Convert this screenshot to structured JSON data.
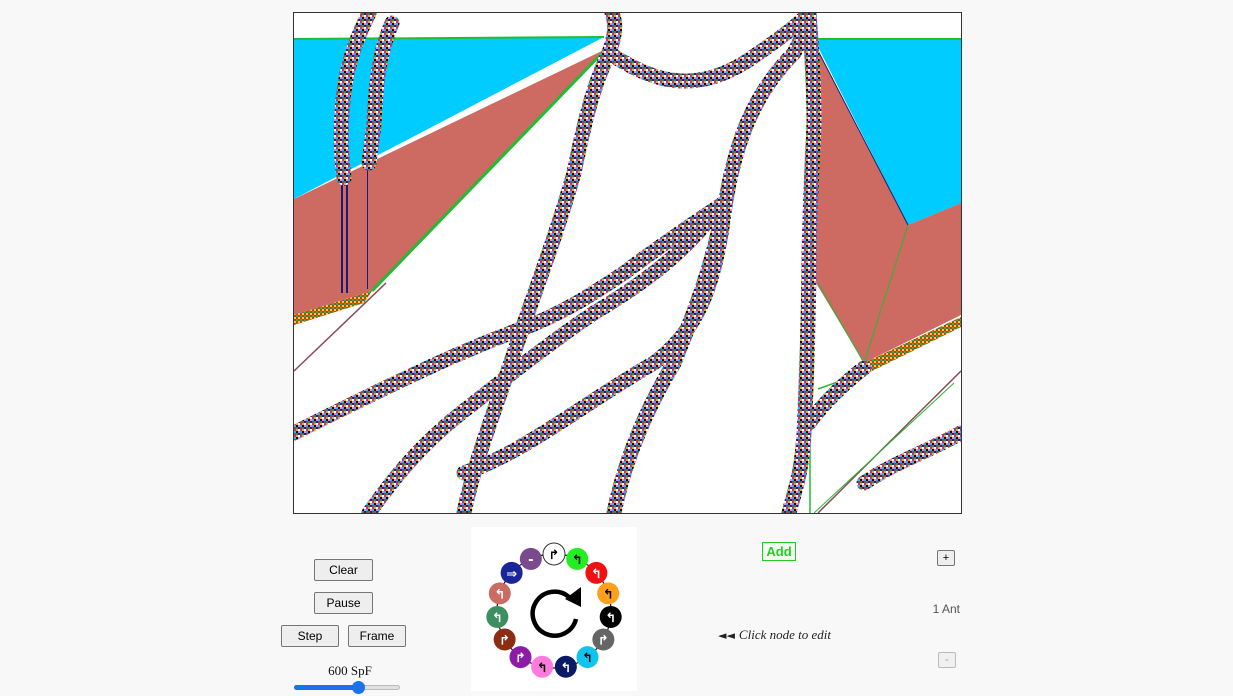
{
  "controls": {
    "clear_label": "Clear",
    "pause_label": "Pause",
    "step_label": "Step",
    "frame_label": "Frame",
    "speed_label": "600 SpF",
    "speed_fraction": 0.6
  },
  "editor": {
    "add_label": "Add",
    "plus_label": "+",
    "minus_label": "-",
    "ant_count_label": "1 Ant",
    "hint_arrows": "◄◄",
    "hint_text": "Click node to edit",
    "center_icon": "rotate-clockwise-icon"
  },
  "rule_nodes": [
    {
      "color": "#ffffff",
      "symbol": "↱"
    },
    {
      "color": "#22ee22",
      "symbol": "↰"
    },
    {
      "color": "#ee1111",
      "symbol": "↰"
    },
    {
      "color": "#ff9f1a",
      "symbol": "↰"
    },
    {
      "color": "#000000",
      "symbol": "↰"
    },
    {
      "color": "#666666",
      "symbol": "↱"
    },
    {
      "color": "#11c4f0",
      "symbol": "↰"
    },
    {
      "color": "#0b1a66",
      "symbol": "↰"
    },
    {
      "color": "#ff7adc",
      "symbol": "↰"
    },
    {
      "color": "#8e1aa8",
      "symbol": "↱"
    },
    {
      "color": "#8a2d12",
      "symbol": "↱"
    },
    {
      "color": "#3c8f5f",
      "symbol": "↰"
    },
    {
      "color": "#cc6b61",
      "symbol": "↰"
    },
    {
      "color": "#1a2599",
      "symbol": "⇒"
    },
    {
      "color": "#7b4a8c",
      "symbol": "-"
    }
  ],
  "palette": {
    "sky": "#00ccff",
    "salmon": "#cd6a62",
    "edge_green": "#22bb33",
    "navy": "#1a1a77",
    "accent": "#1a73e8"
  }
}
